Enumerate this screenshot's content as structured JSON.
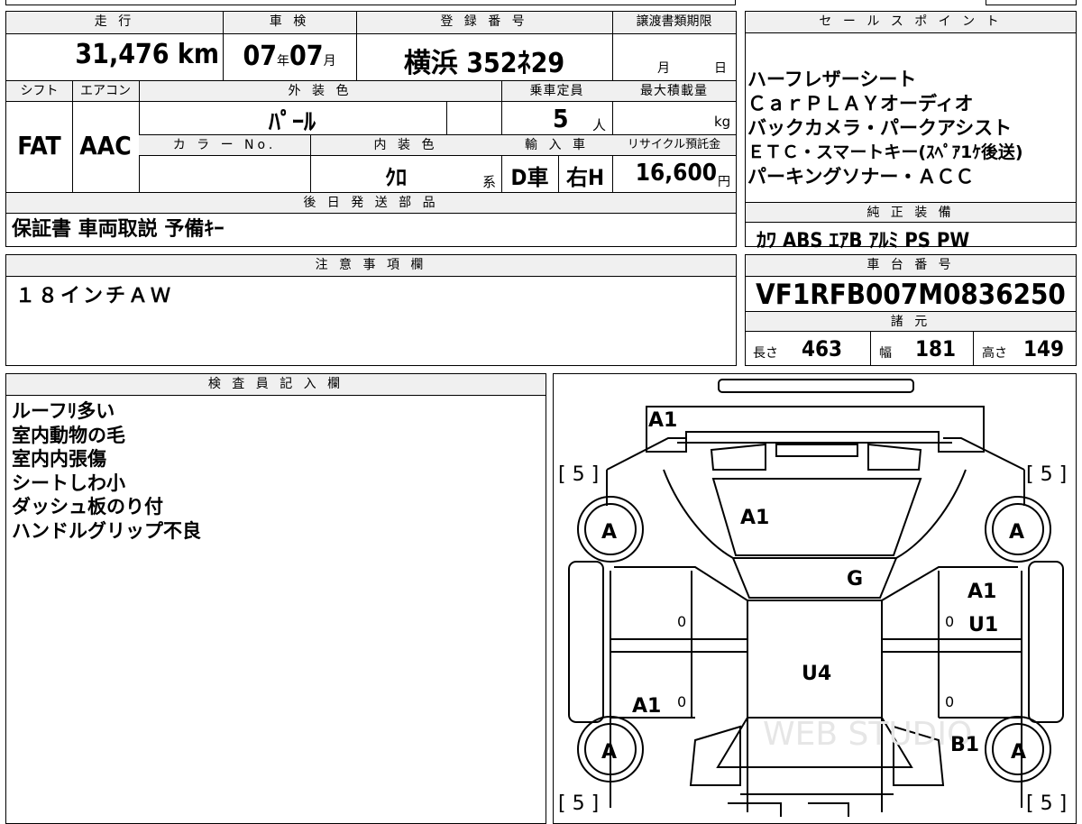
{
  "top_table": {
    "mileage_label": "走 行",
    "mileage_value": "31,476 km",
    "shaken_label": "車 検",
    "shaken_year": "07",
    "shaken_year_unit": "年",
    "shaken_month": "07",
    "shaken_month_unit": "月",
    "reg_label": "登 録 番 号",
    "reg_value": "横浜 352ﾈ29",
    "transfer_label": "譲渡書類期限",
    "transfer_month_unit": "月",
    "transfer_day_unit": "日",
    "shift_label": "シフト",
    "shift_value": "FAT",
    "ac_label": "エアコン",
    "ac_value": "AAC",
    "exterior_label": "外 装 色",
    "exterior_value": "ﾊﾟｰﾙ",
    "capacity_label": "乗車定員",
    "capacity_value": "5",
    "capacity_unit": "人",
    "load_label": "最大積載量",
    "load_unit": "kg",
    "color_no_label": "カ ラ ー No.",
    "interior_label": "内 装 色",
    "interior_value": "ｸﾛ",
    "interior_unit": "系",
    "import_label": "輸 入 車",
    "import_type": "D車",
    "import_handle": "右H",
    "recycle_label": "リサイクル預託金",
    "recycle_value": "16,600",
    "recycle_unit": "円",
    "later_label": "後 日 発 送 部 品",
    "later_value": "保証書 車両取説 予備ｷｰ"
  },
  "sales_points": {
    "label": "セ ー ル ス ポ イ ン ト",
    "lines": [
      "ハーフレザーシート",
      "ＣａｒＰＬＡＹオーディオ",
      "バックカメラ・パークアシスト",
      "ＥＴＣ・スマートキー(ｽﾍﾟｱ1ｹ後送)",
      "パーキングソナー・ＡＣＣ"
    ]
  },
  "equipment": {
    "label": "純 正 装 備",
    "value": "ｶﾜ ABS ｴｱB ｱﾙﾐ PS PW"
  },
  "notes": {
    "label": "注 意 事 項 欄",
    "value": "１８インチＡＷ"
  },
  "chassis": {
    "label": "車 台 番 号",
    "value": "VF1RFB007M0836250"
  },
  "specs": {
    "label": "諸 元",
    "length_label": "長さ",
    "length_value": "463",
    "width_label": "幅",
    "width_value": "181",
    "height_label": "高さ",
    "height_value": "149"
  },
  "inspector": {
    "label": "検 査 員 記 入 欄",
    "lines": [
      "ルーフﾘ多い",
      "室内動物の毛",
      "室内内張傷",
      "シートしわ小",
      "ダッシュ板のり付",
      "ハンドルグリップ不良"
    ]
  },
  "diagram": {
    "marks": [
      "A1",
      "A1",
      "G",
      "A1",
      "U1",
      "U4",
      "A1",
      "B1"
    ],
    "tires": [
      "A",
      "A",
      "A",
      "A"
    ],
    "tread": [
      "[ 5 ]",
      "[ 5 ]",
      "[ 5 ]",
      "[ 5 ]"
    ],
    "zeros": [
      "0",
      "0",
      "0",
      "0"
    ],
    "watermark": "WEB STUDIO"
  }
}
